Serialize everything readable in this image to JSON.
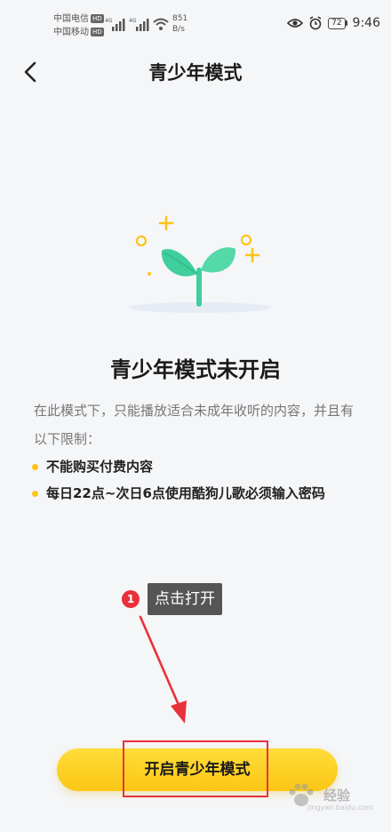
{
  "status_bar": {
    "carrier_1": "中国电信",
    "carrier_2": "中国移动",
    "hd_badge": "HD",
    "net_type": "4G",
    "speed_value": "851",
    "speed_unit": "B/s",
    "battery": "72",
    "time": "9:46"
  },
  "header": {
    "title": "青少年模式"
  },
  "main": {
    "heading": "青少年模式未开启",
    "description": "在此模式下，只能播放适合未成年收听的内容，并且有以下限制：",
    "restrictions": [
      "不能购买付费内容",
      "每日22点~次日6点使用酷狗儿歌必须输入密码"
    ]
  },
  "annotation": {
    "step_number": "1",
    "tooltip": "点击打开"
  },
  "action": {
    "enable_label": "开启青少年模式"
  },
  "watermark": {
    "text": "经验",
    "url": "jingyan.baidu.com"
  },
  "colors": {
    "accent_yellow": "#fcc615",
    "annotation_red": "#e8313b",
    "sprout_green": "#3fcf9c"
  }
}
